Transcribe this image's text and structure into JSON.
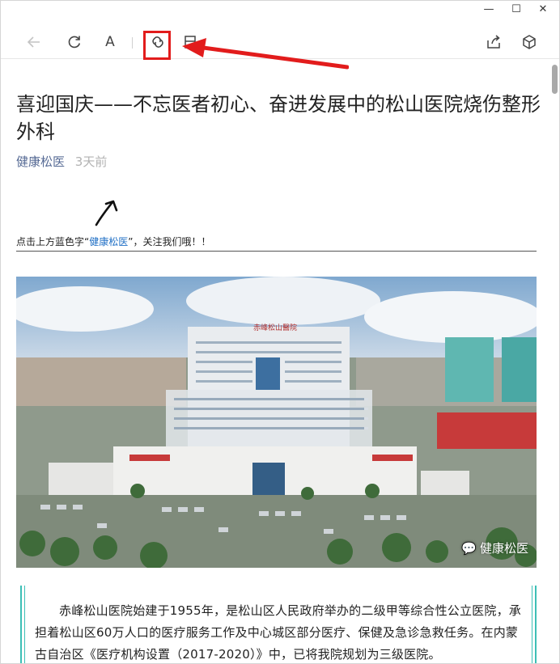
{
  "window": {
    "minimize_glyph": "—",
    "maximize_glyph": "☐",
    "close_glyph": "✕"
  },
  "toolbar": {
    "font_label": "A",
    "icons": [
      "back-arrow-icon",
      "refresh-icon",
      "font-icon",
      "link-icon",
      "book-icon",
      "share-icon",
      "cube-icon"
    ],
    "highlight_color": "#e21c1c"
  },
  "article": {
    "title": "喜迎国庆——不忘医者初心、奋进发展中的松山医院烧伤整形外科",
    "source": "健康松医",
    "time": "3天前",
    "follow_prefix": "点击上方蓝色字“",
    "follow_link": "健康松医",
    "follow_suffix": "”，关注我们哦！！",
    "photo": {
      "sign_text": "赤峰松山醫院",
      "watermark": "健康松医"
    },
    "intro": "赤峰松山医院始建于1955年，是松山区人民政府举办的二级甲等综合性公立医院，承担着松山区60万人口的医疗服务工作及中心城区部分医疗、保健及急诊急救任务。在内蒙古自治区《医疗机构设置（2017-2020）》中，已将我院规划为三级医院。"
  },
  "colors": {
    "source_blue": "#576b95",
    "link_blue": "#1f6fc5",
    "quote_teal": "#3dbfb6"
  }
}
